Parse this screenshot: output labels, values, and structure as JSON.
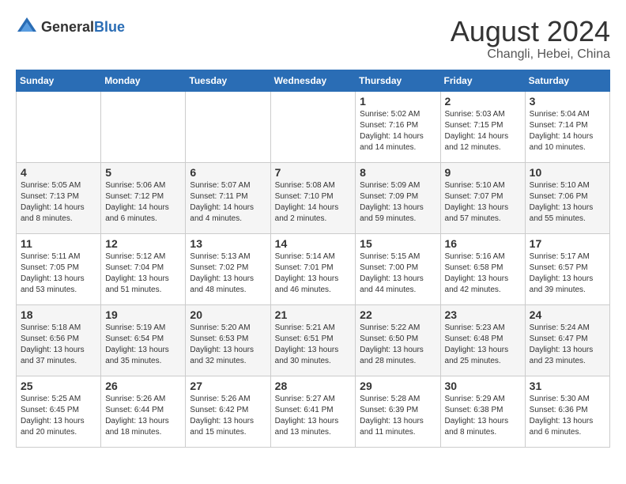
{
  "header": {
    "logo_general": "General",
    "logo_blue": "Blue",
    "title": "August 2024",
    "subtitle": "Changli, Hebei, China"
  },
  "columns": [
    "Sunday",
    "Monday",
    "Tuesday",
    "Wednesday",
    "Thursday",
    "Friday",
    "Saturday"
  ],
  "weeks": [
    [
      {
        "day": "",
        "info": ""
      },
      {
        "day": "",
        "info": ""
      },
      {
        "day": "",
        "info": ""
      },
      {
        "day": "",
        "info": ""
      },
      {
        "day": "1",
        "info": "Sunrise: 5:02 AM\nSunset: 7:16 PM\nDaylight: 14 hours\nand 14 minutes."
      },
      {
        "day": "2",
        "info": "Sunrise: 5:03 AM\nSunset: 7:15 PM\nDaylight: 14 hours\nand 12 minutes."
      },
      {
        "day": "3",
        "info": "Sunrise: 5:04 AM\nSunset: 7:14 PM\nDaylight: 14 hours\nand 10 minutes."
      }
    ],
    [
      {
        "day": "4",
        "info": "Sunrise: 5:05 AM\nSunset: 7:13 PM\nDaylight: 14 hours\nand 8 minutes."
      },
      {
        "day": "5",
        "info": "Sunrise: 5:06 AM\nSunset: 7:12 PM\nDaylight: 14 hours\nand 6 minutes."
      },
      {
        "day": "6",
        "info": "Sunrise: 5:07 AM\nSunset: 7:11 PM\nDaylight: 14 hours\nand 4 minutes."
      },
      {
        "day": "7",
        "info": "Sunrise: 5:08 AM\nSunset: 7:10 PM\nDaylight: 14 hours\nand 2 minutes."
      },
      {
        "day": "8",
        "info": "Sunrise: 5:09 AM\nSunset: 7:09 PM\nDaylight: 13 hours\nand 59 minutes."
      },
      {
        "day": "9",
        "info": "Sunrise: 5:10 AM\nSunset: 7:07 PM\nDaylight: 13 hours\nand 57 minutes."
      },
      {
        "day": "10",
        "info": "Sunrise: 5:10 AM\nSunset: 7:06 PM\nDaylight: 13 hours\nand 55 minutes."
      }
    ],
    [
      {
        "day": "11",
        "info": "Sunrise: 5:11 AM\nSunset: 7:05 PM\nDaylight: 13 hours\nand 53 minutes."
      },
      {
        "day": "12",
        "info": "Sunrise: 5:12 AM\nSunset: 7:04 PM\nDaylight: 13 hours\nand 51 minutes."
      },
      {
        "day": "13",
        "info": "Sunrise: 5:13 AM\nSunset: 7:02 PM\nDaylight: 13 hours\nand 48 minutes."
      },
      {
        "day": "14",
        "info": "Sunrise: 5:14 AM\nSunset: 7:01 PM\nDaylight: 13 hours\nand 46 minutes."
      },
      {
        "day": "15",
        "info": "Sunrise: 5:15 AM\nSunset: 7:00 PM\nDaylight: 13 hours\nand 44 minutes."
      },
      {
        "day": "16",
        "info": "Sunrise: 5:16 AM\nSunset: 6:58 PM\nDaylight: 13 hours\nand 42 minutes."
      },
      {
        "day": "17",
        "info": "Sunrise: 5:17 AM\nSunset: 6:57 PM\nDaylight: 13 hours\nand 39 minutes."
      }
    ],
    [
      {
        "day": "18",
        "info": "Sunrise: 5:18 AM\nSunset: 6:56 PM\nDaylight: 13 hours\nand 37 minutes."
      },
      {
        "day": "19",
        "info": "Sunrise: 5:19 AM\nSunset: 6:54 PM\nDaylight: 13 hours\nand 35 minutes."
      },
      {
        "day": "20",
        "info": "Sunrise: 5:20 AM\nSunset: 6:53 PM\nDaylight: 13 hours\nand 32 minutes."
      },
      {
        "day": "21",
        "info": "Sunrise: 5:21 AM\nSunset: 6:51 PM\nDaylight: 13 hours\nand 30 minutes."
      },
      {
        "day": "22",
        "info": "Sunrise: 5:22 AM\nSunset: 6:50 PM\nDaylight: 13 hours\nand 28 minutes."
      },
      {
        "day": "23",
        "info": "Sunrise: 5:23 AM\nSunset: 6:48 PM\nDaylight: 13 hours\nand 25 minutes."
      },
      {
        "day": "24",
        "info": "Sunrise: 5:24 AM\nSunset: 6:47 PM\nDaylight: 13 hours\nand 23 minutes."
      }
    ],
    [
      {
        "day": "25",
        "info": "Sunrise: 5:25 AM\nSunset: 6:45 PM\nDaylight: 13 hours\nand 20 minutes."
      },
      {
        "day": "26",
        "info": "Sunrise: 5:26 AM\nSunset: 6:44 PM\nDaylight: 13 hours\nand 18 minutes."
      },
      {
        "day": "27",
        "info": "Sunrise: 5:26 AM\nSunset: 6:42 PM\nDaylight: 13 hours\nand 15 minutes."
      },
      {
        "day": "28",
        "info": "Sunrise: 5:27 AM\nSunset: 6:41 PM\nDaylight: 13 hours\nand 13 minutes."
      },
      {
        "day": "29",
        "info": "Sunrise: 5:28 AM\nSunset: 6:39 PM\nDaylight: 13 hours\nand 11 minutes."
      },
      {
        "day": "30",
        "info": "Sunrise: 5:29 AM\nSunset: 6:38 PM\nDaylight: 13 hours\nand 8 minutes."
      },
      {
        "day": "31",
        "info": "Sunrise: 5:30 AM\nSunset: 6:36 PM\nDaylight: 13 hours\nand 6 minutes."
      }
    ]
  ]
}
